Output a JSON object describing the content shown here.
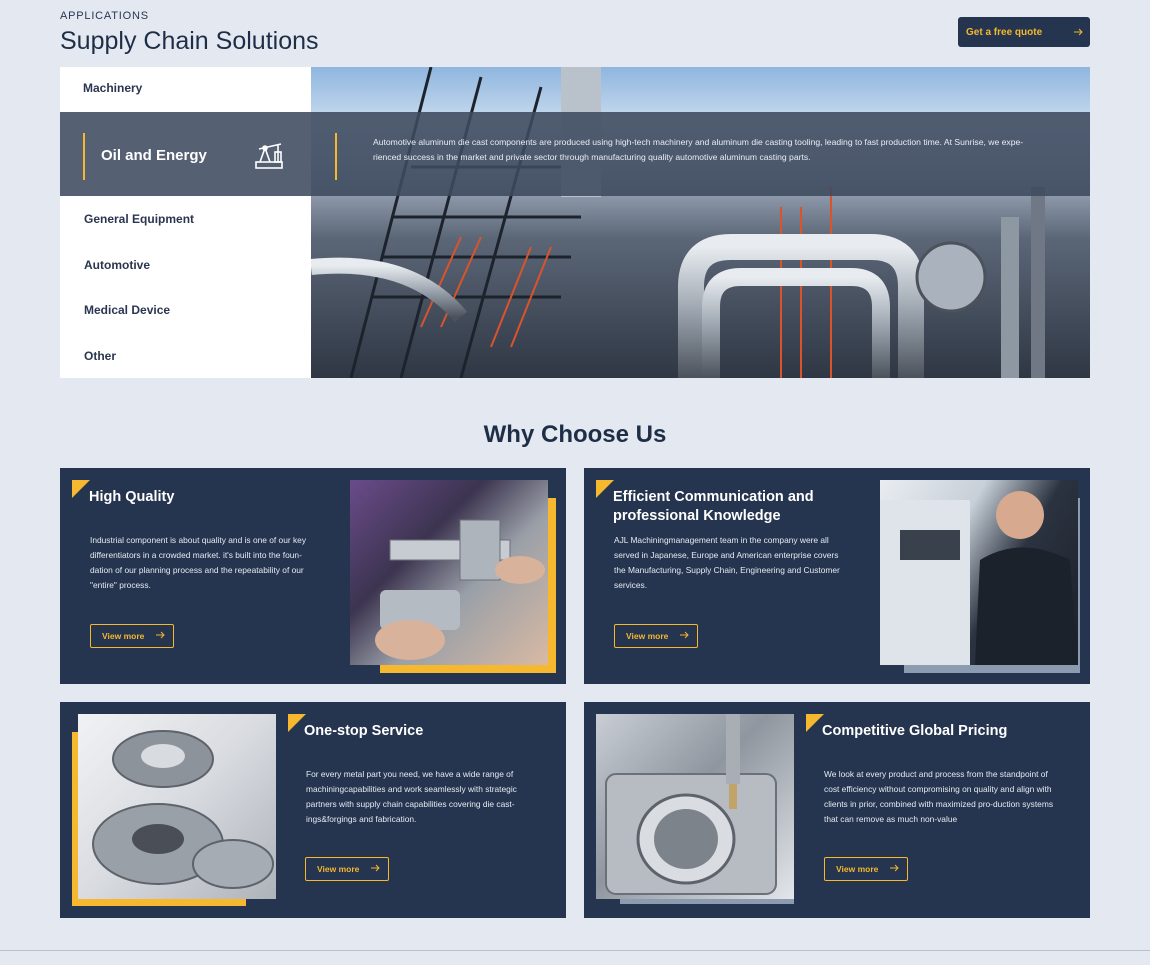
{
  "header": {
    "eyebrow": "APPLICATIONS",
    "title": "Supply Chain Solutions",
    "quote_button": "Get a free quote"
  },
  "applications": {
    "items": [
      "Machinery",
      "Oil and Energy",
      "General Equipment",
      "Automotive",
      "Medical Device",
      "Other"
    ],
    "active": "Oil and Energy",
    "active_icon": "oil-pump-icon",
    "active_description": "Automotive aluminum die cast components are produced using high-tech machinery and aluminum die casting tooling, leading to fast production time. At Sunrise, we expe-rienced success in the market and private sector through manufacturing quality automotive aluminum casting parts."
  },
  "why": {
    "title": "Why Choose Us",
    "cards": [
      {
        "title": "High Quality",
        "text": "Industrial component is about quality and is one of our key differentiators in a crowded market.  it's built into the foun-dation of our planning process and the repeatability of our \"entire\" process.",
        "button": "View more"
      },
      {
        "title": "Efficient Communication and professional Knowledge",
        "text": "AJL Machiningmanagement team in the company were all served in Japanese, Europe and American enterprise covers the Manufacturing, Supply Chain, Engineering and Customer services.",
        "button": "View more"
      },
      {
        "title": "One-stop Service",
        "text": "For every metal part you need, we have a wide range of machiningcapabilities and work seamlessly with strategic partners with supply chain capabilities covering die cast-ings&forgings and fabrication.",
        "button": "View more"
      },
      {
        "title": "Competitive Global Pricing",
        "text": "We look at every product and process from the standpoint of cost efficiency without compromising on quality and align with clients in prior, combined with maximized pro-duction systems that can remove as much non-value",
        "button": "View more"
      }
    ]
  },
  "colors": {
    "accent": "#f5b82e",
    "navy": "#25344f",
    "background": "#e4e9f1"
  }
}
